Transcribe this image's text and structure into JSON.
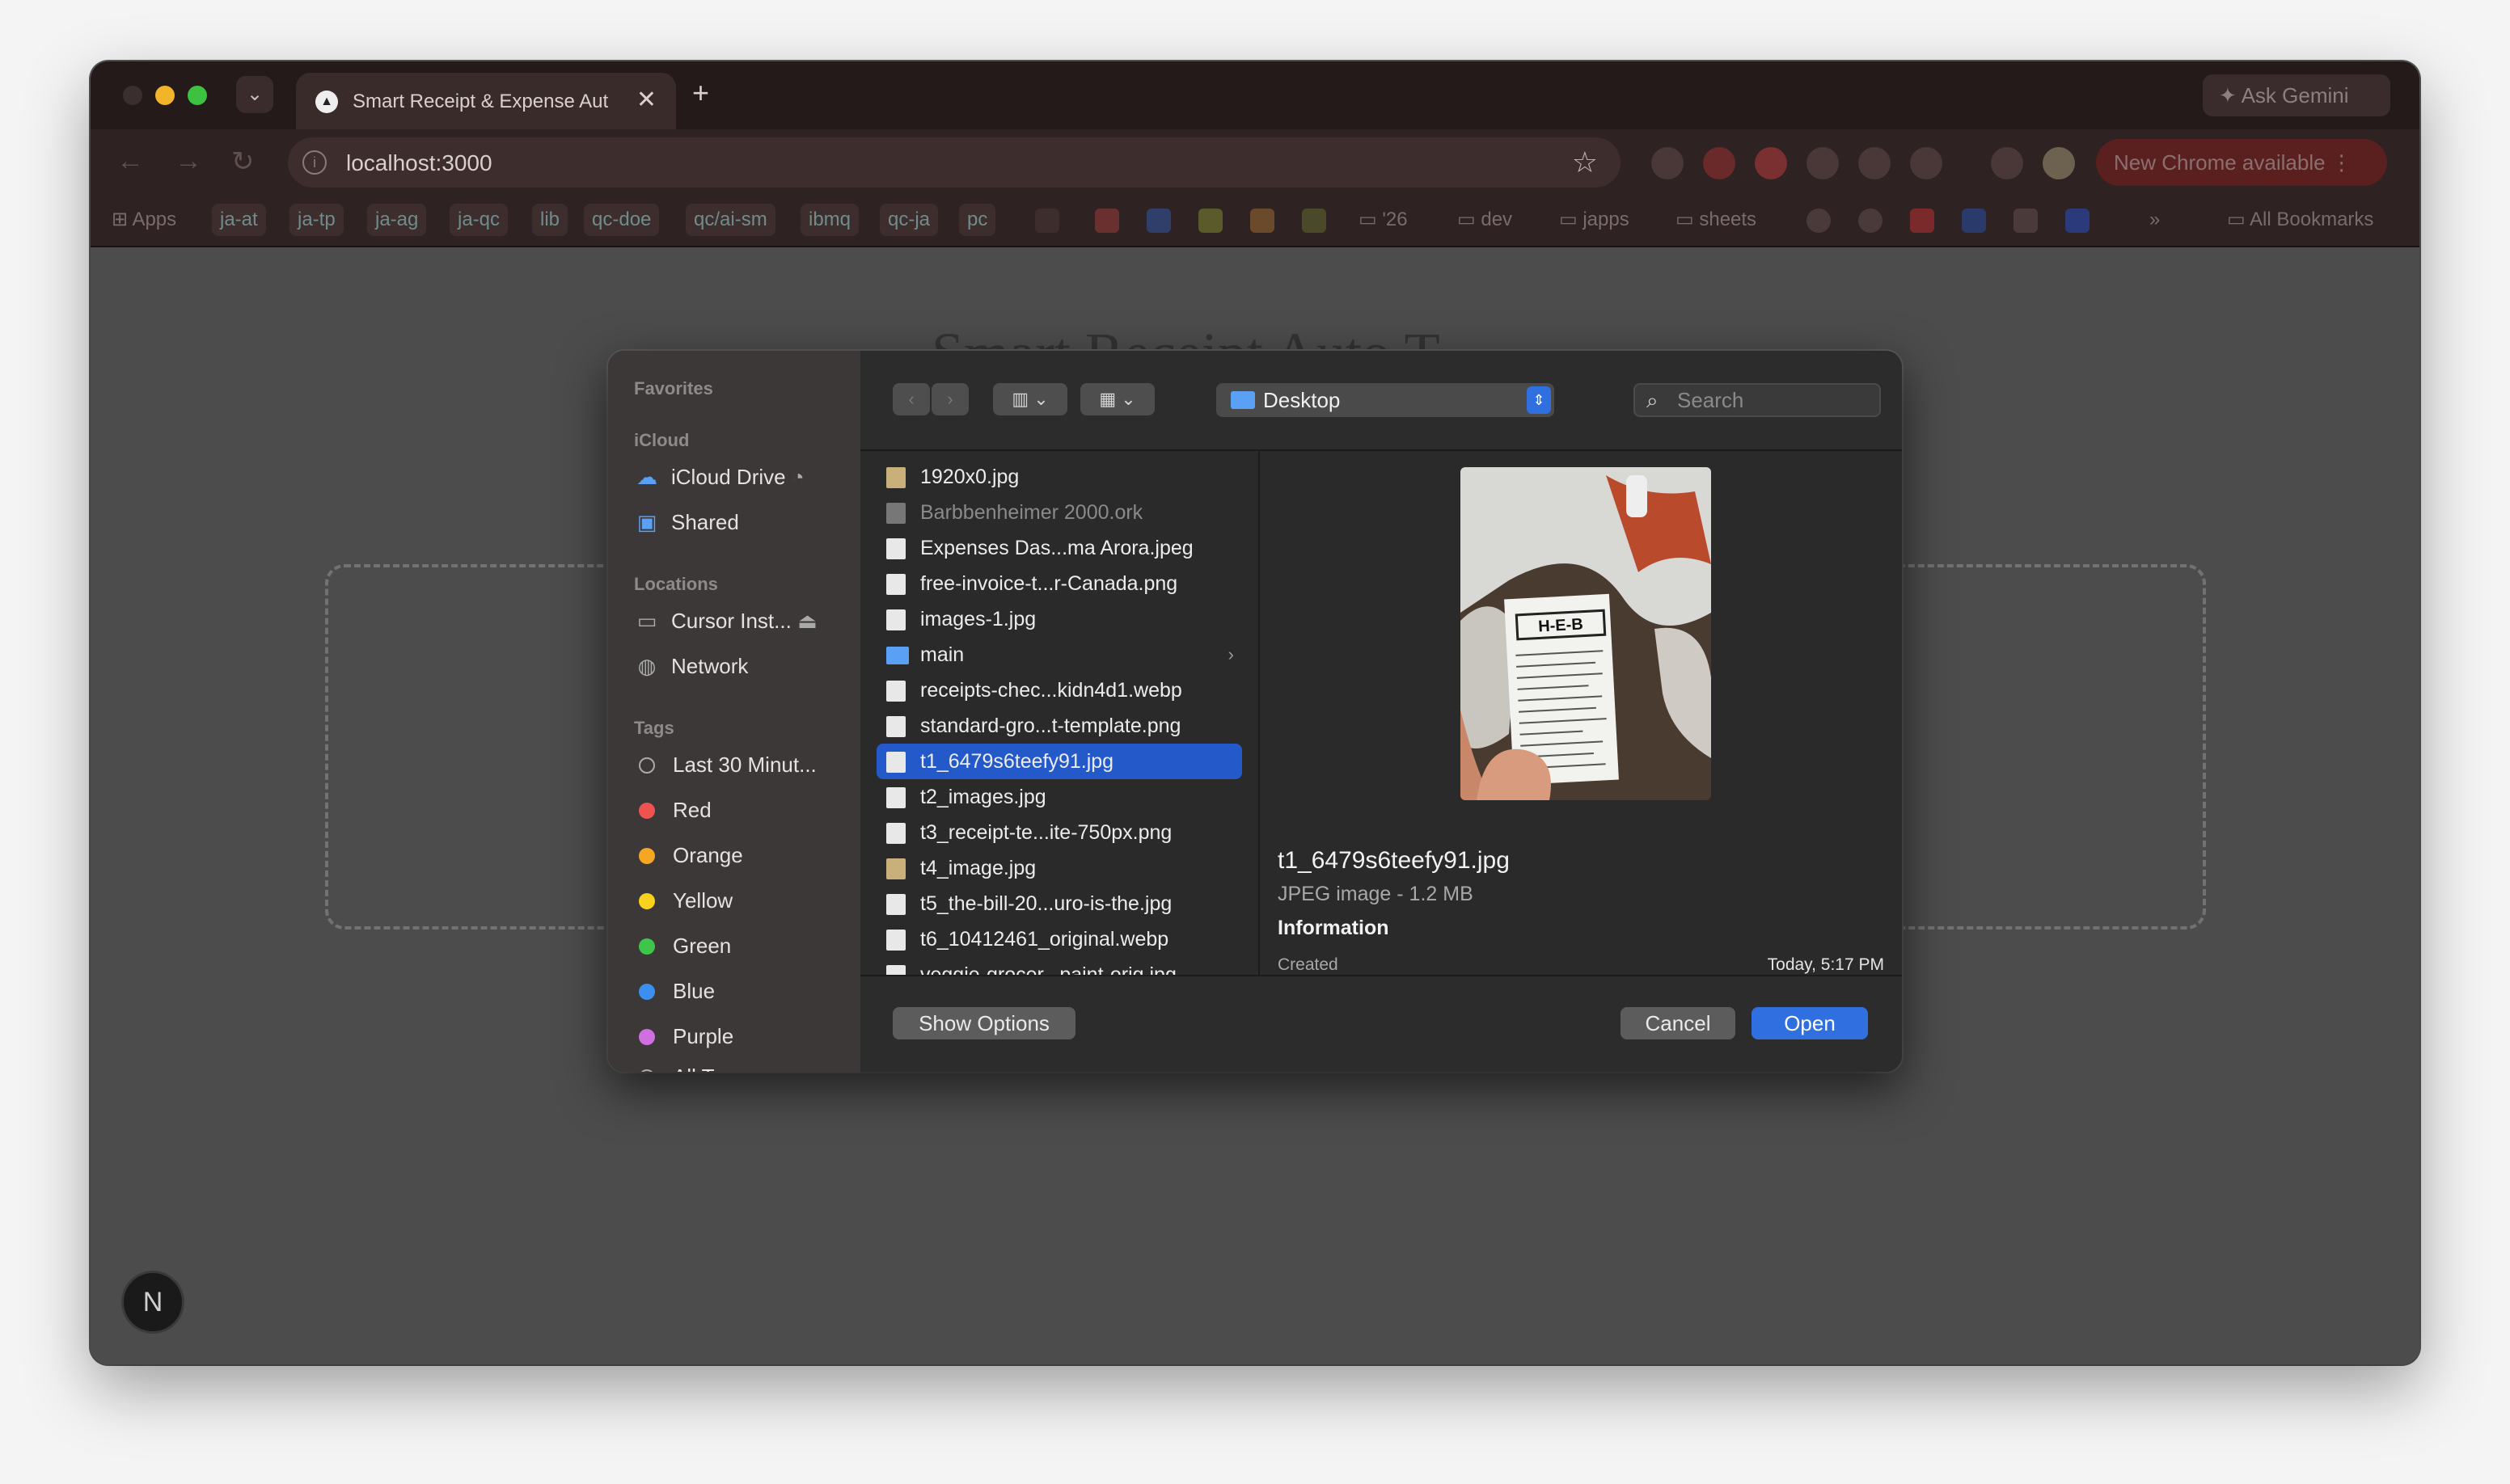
{
  "browser": {
    "tab_title": "Smart Receipt & Expense Aut",
    "tab_close": "✕",
    "new_tab": "+",
    "ask_gemini": "Ask Gemini",
    "url": "localhost:3000",
    "new_chrome": "New Chrome available",
    "bookmarks": [
      "Apps",
      "ja-at",
      "ja-tp",
      "ja-ag",
      "ja-qc",
      "lib",
      "qc-doe",
      "qc/ai-sm",
      "ibmq",
      "qc-ja",
      "pc"
    ],
    "bookmark_folders": [
      "'26",
      "dev",
      "japps",
      "sheets"
    ],
    "all_bookmarks": "All Bookmarks"
  },
  "page": {
    "title": "Smart Receipt Auto T",
    "badge": "N"
  },
  "dialog": {
    "sidebar": {
      "favorites_label": "Favorites",
      "icloud_label": "iCloud",
      "icloud_drive": "iCloud Drive",
      "shared": "Shared",
      "locations_label": "Locations",
      "cursor": "Cursor Inst...",
      "network": "Network",
      "tags_label": "Tags",
      "tags": [
        {
          "label": "Last 30 Minut...",
          "color": "none"
        },
        {
          "label": "Red",
          "color": "#ef5350"
        },
        {
          "label": "Orange",
          "color": "#f5a623"
        },
        {
          "label": "Yellow",
          "color": "#f8d21c"
        },
        {
          "label": "Green",
          "color": "#3ec64a"
        },
        {
          "label": "Blue",
          "color": "#3a8ff0"
        },
        {
          "label": "Purple",
          "color": "#d070e0"
        }
      ],
      "all_tags": "All Tags..."
    },
    "location": "Desktop",
    "search_placeholder": "Search",
    "files": [
      {
        "name": "1920x0.jpg",
        "kind": "photo"
      },
      {
        "name": "Barbbenheimer 2000.ork",
        "kind": "dim"
      },
      {
        "name": "Expenses Das...ma Arora.jpeg",
        "kind": "doc"
      },
      {
        "name": "free-invoice-t...r-Canada.png",
        "kind": "doc"
      },
      {
        "name": "images-1.jpg",
        "kind": "doc"
      },
      {
        "name": "main",
        "kind": "folder"
      },
      {
        "name": "receipts-chec...kidn4d1.webp",
        "kind": "doc"
      },
      {
        "name": "standard-gro...t-template.png",
        "kind": "doc"
      },
      {
        "name": "t1_6479s6teefy91.jpg",
        "kind": "selected"
      },
      {
        "name": "t2_images.jpg",
        "kind": "doc"
      },
      {
        "name": "t3_receipt-te...ite-750px.png",
        "kind": "doc"
      },
      {
        "name": "t4_image.jpg",
        "kind": "photo"
      },
      {
        "name": "t5_the-bill-20...uro-is-the.jpg",
        "kind": "doc"
      },
      {
        "name": "t6_10412461_original.webp",
        "kind": "doc"
      },
      {
        "name": "veggie-grocer...paint-orig.jpg",
        "kind": "doc"
      }
    ],
    "preview": {
      "name": "t1_6479s6teefy91.jpg",
      "type": "JPEG image - 1.2 MB",
      "info_label": "Information",
      "created_label": "Created",
      "created_value": "Today, 5:17 PM",
      "receipt_logo": "H-E-B"
    },
    "show_options": "Show Options",
    "cancel": "Cancel",
    "open": "Open"
  }
}
